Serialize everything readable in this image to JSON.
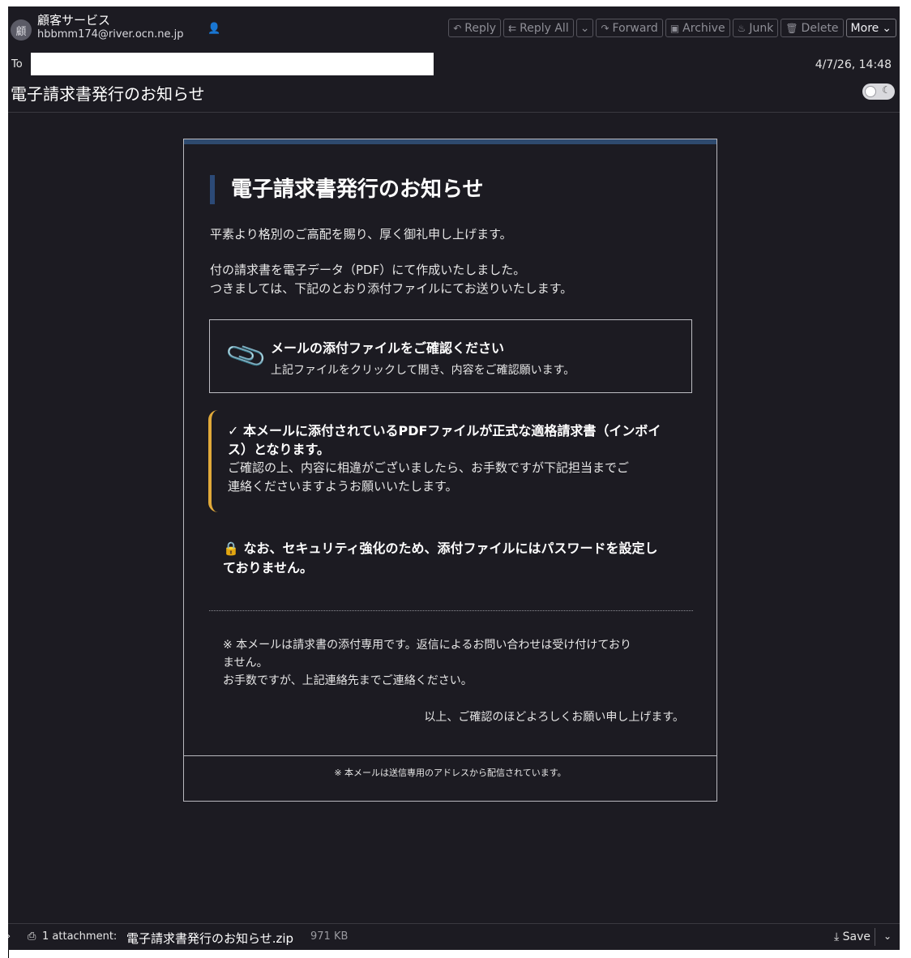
{
  "header": {
    "avatar_letter": "顧",
    "from_name": "顧客サービス",
    "from_address": "hbbmm174@river.ocn.ne.jp",
    "to_label": "To",
    "date": "4/7/26, 14:48",
    "subject": "電子請求書発行のお知らせ"
  },
  "toolbar": {
    "reply": "Reply",
    "reply_all": "Reply All",
    "forward": "Forward",
    "archive": "Archive",
    "junk": "Junk",
    "delete": "Delete",
    "more": "More"
  },
  "body": {
    "title": "電子請求書発行のお知らせ",
    "greeting": "平素より格別のご高配を賜り、厚く御礼申し上げます。",
    "line1": "付の請求書を電子データ（PDF）にて作成いたしました。",
    "line2": "つきましては、下記のとおり添付ファイルにてお送りいたします。",
    "attach_box": {
      "title": "メールの添付ファイルをご確認ください",
      "subtitle": "上記ファイルをクリックして開き、内容をご確認願います。"
    },
    "notice": {
      "bold_1": "✓ 本メールに添付されているPDFファイルが正式な適格請求書（インボイ",
      "bold_2": "ス）となります。",
      "text_1": "ご確認の上、内容に相違がございましたら、お手数ですが下記担当までご",
      "text_2": "連絡くださいますようお願いいたします。"
    },
    "security_1": "なお、セキュリティ強化のため、添付ファイルにはパスワードを設定し",
    "security_2": "ておりません。",
    "footnote_1": "※ 本メールは請求書の添付専用です。返信によるお問い合わせは受け付けており",
    "footnote_2": "ません。",
    "footnote_3": "お手数ですが、上記連絡先までご連絡ください。",
    "closing": "以上、ご確認のほどよろしくお願い申し上げます。",
    "footer": "※ 本メールは送信専用のアドレスから配信されています。"
  },
  "attachment_bar": {
    "count_label": "1 attachment:",
    "file_name": "電子請求書発行のお知らせ.zip",
    "file_size": "971 KB",
    "save_label": "Save"
  }
}
